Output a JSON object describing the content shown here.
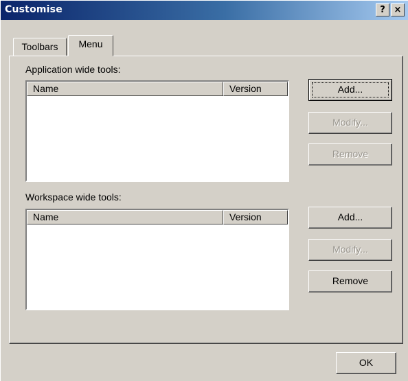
{
  "window": {
    "title": "Customise",
    "help_button": "?",
    "close_button": "×"
  },
  "tabs": [
    {
      "label": "Toolbars",
      "selected": false
    },
    {
      "label": "Menu",
      "selected": true
    }
  ],
  "application_tools": {
    "label": "Application wide tools:",
    "label_accel": "p",
    "columns": [
      "Name",
      "Version"
    ],
    "rows": [],
    "buttons": {
      "add": {
        "label": "Add...",
        "enabled": true,
        "default": true
      },
      "modify": {
        "label": "Modify...",
        "enabled": false
      },
      "remove": {
        "label": "Remove",
        "enabled": false
      }
    }
  },
  "workspace_tools": {
    "label": "Workspace wide tools:",
    "label_accel": "W",
    "columns": [
      "Name",
      "Version"
    ],
    "rows": [],
    "buttons": {
      "add": {
        "label": "Add...",
        "enabled": true
      },
      "modify": {
        "label": "Modify...",
        "enabled": false
      },
      "remove": {
        "label": "Remove",
        "enabled": true
      }
    }
  },
  "footer": {
    "ok_label": "OK"
  }
}
